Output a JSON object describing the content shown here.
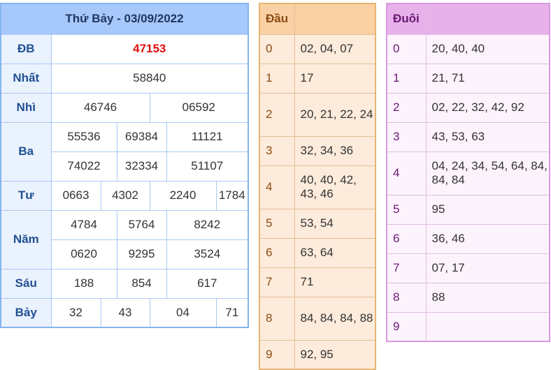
{
  "results": {
    "title": "Thứ Bảy - 03/09/2022",
    "prizes": {
      "db": {
        "label": "ĐB",
        "values": [
          "47153"
        ]
      },
      "nhat": {
        "label": "Nhất",
        "values": [
          "58840"
        ]
      },
      "nhi": {
        "label": "Nhì",
        "values": [
          "46746",
          "06592"
        ]
      },
      "ba": {
        "label": "Ba",
        "values": [
          "55536",
          "69384",
          "11121",
          "74022",
          "32334",
          "51107"
        ]
      },
      "tu": {
        "label": "Tư",
        "values": [
          "0663",
          "4302",
          "2240",
          "1784"
        ]
      },
      "nam": {
        "label": "Năm",
        "values": [
          "4784",
          "5764",
          "8242",
          "0620",
          "9295",
          "3524"
        ]
      },
      "sau": {
        "label": "Sáu",
        "values": [
          "188",
          "854",
          "617"
        ]
      },
      "bay": {
        "label": "Bảy",
        "values": [
          "32",
          "43",
          "04",
          "71"
        ]
      }
    }
  },
  "dau": {
    "header": "Đầu",
    "rows": [
      {
        "k": "0",
        "v": "02, 04, 07"
      },
      {
        "k": "1",
        "v": "17"
      },
      {
        "k": "2",
        "v": "20, 21, 22, 24"
      },
      {
        "k": "3",
        "v": "32, 34, 36"
      },
      {
        "k": "4",
        "v": "40, 40, 42, 43, 46"
      },
      {
        "k": "5",
        "v": "53, 54"
      },
      {
        "k": "6",
        "v": "63, 64"
      },
      {
        "k": "7",
        "v": "71"
      },
      {
        "k": "8",
        "v": "84, 84, 84, 88"
      },
      {
        "k": "9",
        "v": "92, 95"
      }
    ]
  },
  "duoi": {
    "header": "Đuôi",
    "rows": [
      {
        "k": "0",
        "v": "20, 40, 40"
      },
      {
        "k": "1",
        "v": "21, 71"
      },
      {
        "k": "2",
        "v": "02, 22, 32, 42, 92"
      },
      {
        "k": "3",
        "v": "43, 53, 63"
      },
      {
        "k": "4",
        "v": "04, 24, 34, 54, 64, 84, 84, 84"
      },
      {
        "k": "5",
        "v": "95"
      },
      {
        "k": "6",
        "v": "36, 46"
      },
      {
        "k": "7",
        "v": "07, 17"
      },
      {
        "k": "8",
        "v": "88"
      },
      {
        "k": "9",
        "v": ""
      }
    ]
  },
  "colors": {
    "results_header_bg": "#a7c8fb",
    "special_prize": "#e01212",
    "dau_header_bg": "#f9d1a5",
    "duoi_header_bg": "#e7b1ea"
  }
}
